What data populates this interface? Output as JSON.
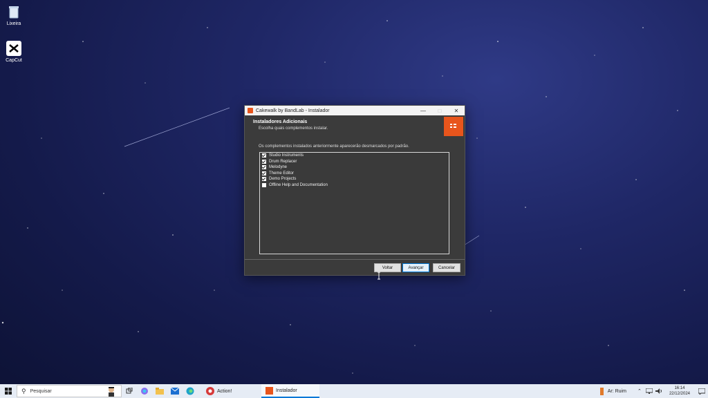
{
  "desktop": {
    "icons": [
      {
        "label": "Lixeira",
        "icon": "recycle-bin-icon"
      },
      {
        "label": "CapCut",
        "icon": "capcut-icon"
      }
    ]
  },
  "dialog": {
    "title": "Cakewalk by BandLab - Instalador",
    "header_title": "Instaladores Adicionais",
    "header_subtitle": "Escolha quais complementos instalar.",
    "note": "Os complementos instalados anteriormente aparecerão desmarcados por padrão.",
    "items": [
      {
        "label": "Studio Instruments",
        "checked": true
      },
      {
        "label": "Drum Replacer",
        "checked": true
      },
      {
        "label": "Melodyne",
        "checked": true
      },
      {
        "label": "Theme Editor",
        "checked": true
      },
      {
        "label": "Demo Projects",
        "checked": true
      },
      {
        "label": "Offline Help and Documentation",
        "checked": false
      }
    ],
    "buttons": {
      "back": "Voltar",
      "next": "Avançar",
      "cancel": "Cancelar"
    },
    "accent": "#e8551c"
  },
  "taskbar": {
    "search_placeholder": "Pesquisar",
    "apps": [
      {
        "label": "Action!",
        "active": false
      },
      {
        "label": "Instalador",
        "active": true
      }
    ],
    "weather": "Ar: Ruim",
    "time": "16:14",
    "date": "22/12/2024"
  }
}
